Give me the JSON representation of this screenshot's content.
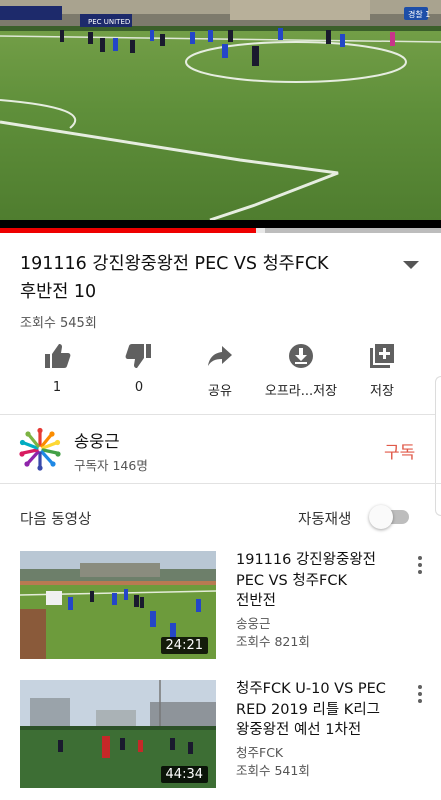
{
  "player": {
    "progress_fraction": 0.58,
    "buffer_fraction": 0.6,
    "scoreboard_team": "PEC UNITED"
  },
  "video": {
    "title_line1": "191116 강진왕중왕전 PEC VS 청주FCK",
    "title_line2": "후반전  10",
    "views": "조회수 545회"
  },
  "actions": {
    "like_count": "1",
    "dislike_count": "0",
    "share_label": "공유",
    "offline_label": "오프라...저장",
    "save_label": "저장"
  },
  "channel": {
    "name": "송웅근",
    "subscribers": "구독자 146명",
    "subscribe_label": "구독"
  },
  "up_next": {
    "label": "다음 동영상",
    "autoplay_label": "자동재생",
    "autoplay_on": false
  },
  "recommendations": [
    {
      "title_lines": [
        "191116 강진왕중왕전",
        "PEC VS 청주FCK",
        "전반전"
      ],
      "channel": "송웅근",
      "views": "조회수 821회",
      "duration": "24:21"
    },
    {
      "title_lines": [
        "청주FCK U-10 VS PEC",
        "RED 2019 리틀 K리그",
        "왕중왕전 예선 1차전"
      ],
      "channel": "청주FCK",
      "views": "조회수 541회",
      "duration": "44:34"
    }
  ],
  "colors": {
    "progress": "#e00000",
    "subscribe": "#e05a4a",
    "pitch": "#5f8f3a"
  }
}
